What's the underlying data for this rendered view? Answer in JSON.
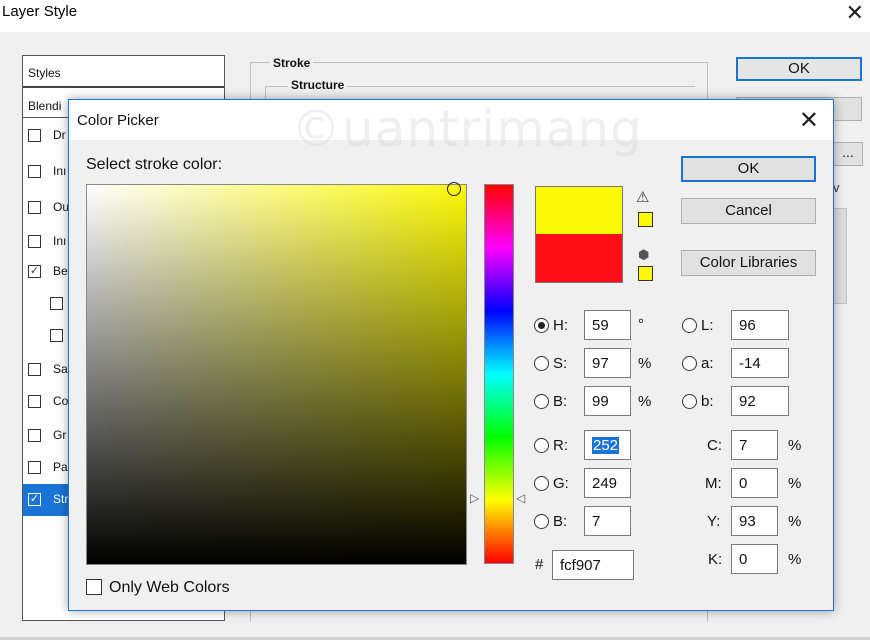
{
  "layer_style": {
    "title": "Layer Style",
    "styles_header": "Styles",
    "blending_header": "Blendi",
    "items": [
      {
        "label": "Dr",
        "checked": false,
        "indent": false,
        "selected": false
      },
      {
        "label": "Inı",
        "checked": false,
        "indent": false,
        "selected": false
      },
      {
        "label": "Ou",
        "checked": false,
        "indent": false,
        "selected": false
      },
      {
        "label": "Inı",
        "checked": false,
        "indent": false,
        "selected": false
      },
      {
        "label": "Be",
        "checked": true,
        "indent": false,
        "selected": false
      },
      {
        "label": "",
        "checked": false,
        "indent": true,
        "selected": false
      },
      {
        "label": "",
        "checked": false,
        "indent": true,
        "selected": false
      },
      {
        "label": "Sa",
        "checked": false,
        "indent": false,
        "selected": false
      },
      {
        "label": "Co",
        "checked": false,
        "indent": false,
        "selected": false
      },
      {
        "label": "Gr",
        "checked": false,
        "indent": false,
        "selected": false
      },
      {
        "label": "Pa",
        "checked": false,
        "indent": false,
        "selected": false
      },
      {
        "label": "Str",
        "checked": true,
        "indent": false,
        "selected": true
      }
    ],
    "stroke_title": "Stroke",
    "structure_title": "Structure",
    "ok_label": "OK",
    "dots_label": "...",
    "preview_partial": "v"
  },
  "color_picker": {
    "title": "Color Picker",
    "prompt": "Select stroke color:",
    "watermark": "©uantrimang",
    "buttons": {
      "ok": "OK",
      "cancel": "Cancel",
      "libraries": "Color Libraries"
    },
    "new_color": "#fcf907",
    "old_color": "#ff0f17",
    "hsb": [
      {
        "label": "H:",
        "value": "59",
        "unit": "°",
        "checked": true
      },
      {
        "label": "S:",
        "value": "97",
        "unit": "%",
        "checked": false
      },
      {
        "label": "B:",
        "value": "99",
        "unit": "%",
        "checked": false
      }
    ],
    "rgb": [
      {
        "label": "R:",
        "value": "252",
        "checked": false
      },
      {
        "label": "G:",
        "value": "249",
        "checked": false
      },
      {
        "label": "B:",
        "value": "7",
        "checked": false
      }
    ],
    "lab": [
      {
        "label": "L:",
        "value": "96"
      },
      {
        "label": "a:",
        "value": "-14"
      },
      {
        "label": "b:",
        "value": "92"
      }
    ],
    "cmyk": [
      {
        "label": "C:",
        "value": "7",
        "unit": "%"
      },
      {
        "label": "M:",
        "value": "0",
        "unit": "%"
      },
      {
        "label": "Y:",
        "value": "93",
        "unit": "%"
      },
      {
        "label": "K:",
        "value": "0",
        "unit": "%"
      }
    ],
    "hex_label": "#",
    "hex_value": "fcf907",
    "web_colors_label": "Only Web Colors",
    "web_colors_checked": false
  }
}
